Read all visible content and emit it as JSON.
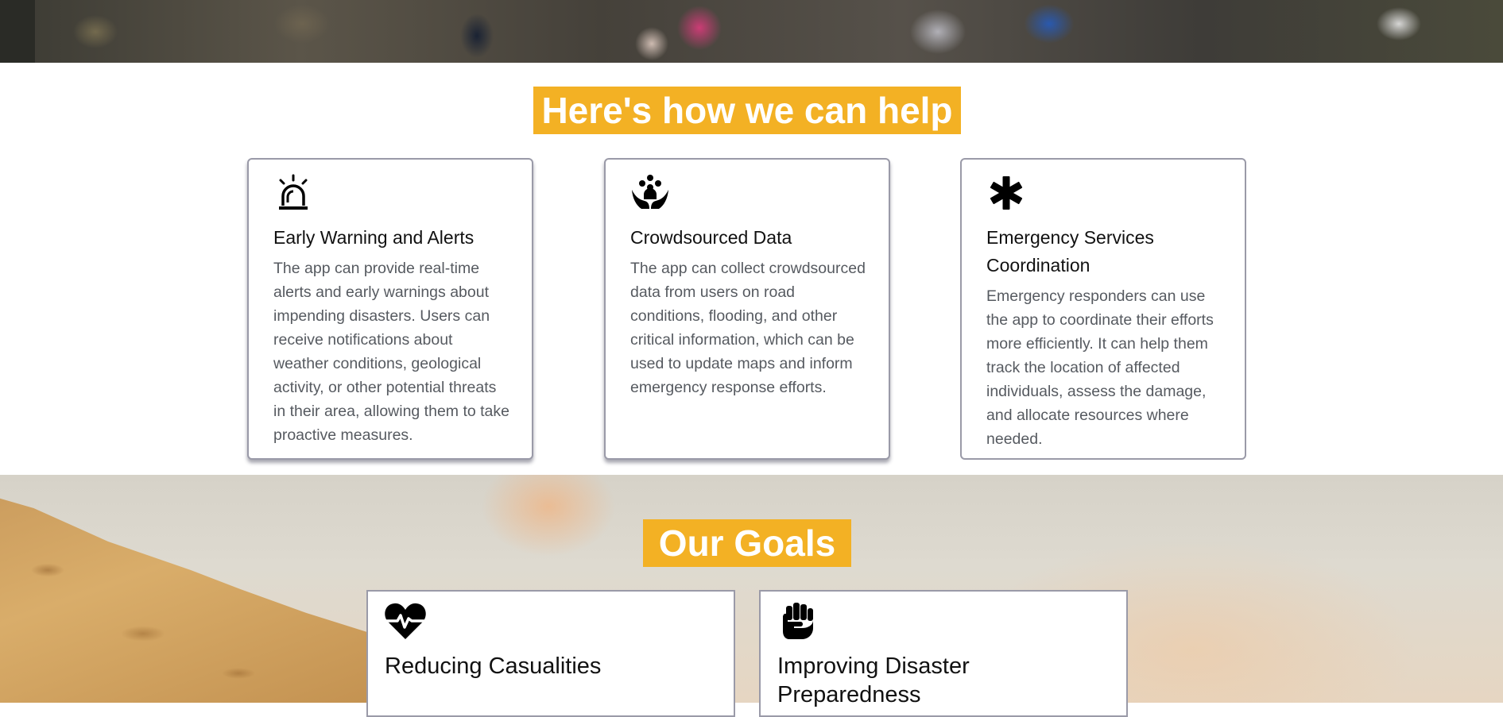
{
  "help_section": {
    "title": "Here's how we can help",
    "cards": [
      {
        "icon": "siren-icon",
        "title": "Early Warning and Alerts",
        "text": "The app can provide real-time alerts and early warnings about impending disasters. Users can receive notifications about weather conditions, geological activity, or other potential threats in their area, allowing them to take proactive measures."
      },
      {
        "icon": "people-hands-icon",
        "title": "Crowdsourced Data",
        "text": "The app can collect crowdsourced data from users on road conditions, flooding, and other critical information, which can be used to update maps and inform emergency response efforts."
      },
      {
        "icon": "asterisk-icon",
        "title": "Emergency Services Coordination",
        "text": "Emergency responders can use the app to coordinate their efforts more efficiently. It can help them track the location of affected individuals, assess the damage, and allocate resources where needed."
      }
    ]
  },
  "goals_section": {
    "title": "Our Goals",
    "cards": [
      {
        "icon": "heart-pulse-icon",
        "title": "Reducing Casualities",
        "text": ""
      },
      {
        "icon": "raised-fist-icon",
        "title": "Improving Disaster Preparedness",
        "text": ""
      }
    ]
  },
  "colors": {
    "accent": "#f3b124",
    "card_border": "#9a9aa8",
    "body_text": "#565a60"
  }
}
